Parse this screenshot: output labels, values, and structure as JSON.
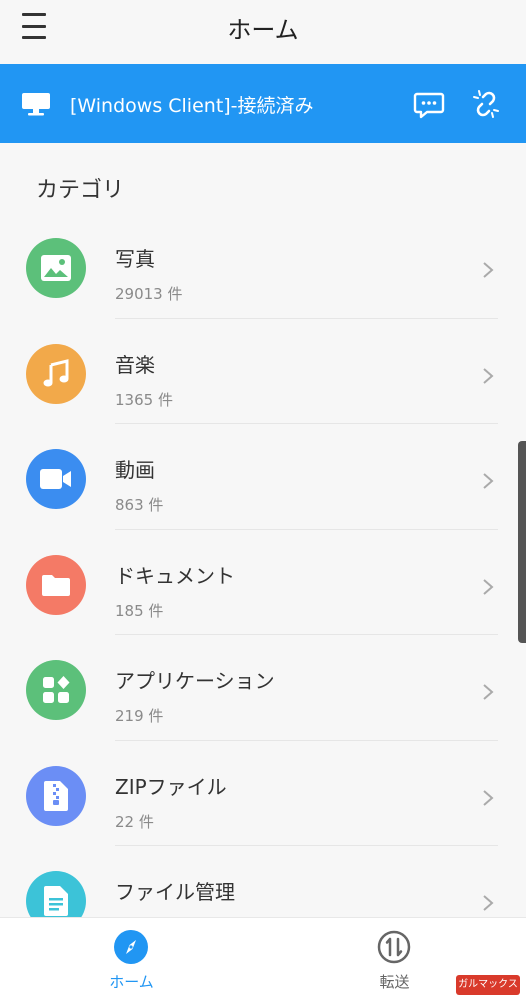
{
  "header": {
    "title": "ホーム"
  },
  "banner": {
    "connection_text": "[Windows Client]-接続済み"
  },
  "section": {
    "title": "カテゴリ"
  },
  "categories": [
    {
      "name": "写真",
      "count": "29013 件",
      "color": "#5cc07a",
      "icon": "image-icon"
    },
    {
      "name": "音楽",
      "count": "1365 件",
      "color": "#f2a94a",
      "icon": "music-icon"
    },
    {
      "name": "動画",
      "count": "863 件",
      "color": "#3b8df0",
      "icon": "video-icon"
    },
    {
      "name": "ドキュメント",
      "count": "185 件",
      "color": "#f47a66",
      "icon": "folder-icon"
    },
    {
      "name": "アプリケーション",
      "count": "219 件",
      "color": "#5cc07a",
      "icon": "apps-icon"
    },
    {
      "name": "ZIPファイル",
      "count": "22 件",
      "color": "#6b8ef5",
      "icon": "zip-icon"
    },
    {
      "name": "ファイル管理",
      "count": "",
      "color": "#3cc3d8",
      "icon": "file-icon"
    }
  ],
  "bottom_nav": {
    "home_label": "ホーム",
    "transfer_label": "転送",
    "active_color": "#2196f3",
    "inactive_color": "#666666"
  },
  "watermark": {
    "text": "ガルマックス"
  }
}
